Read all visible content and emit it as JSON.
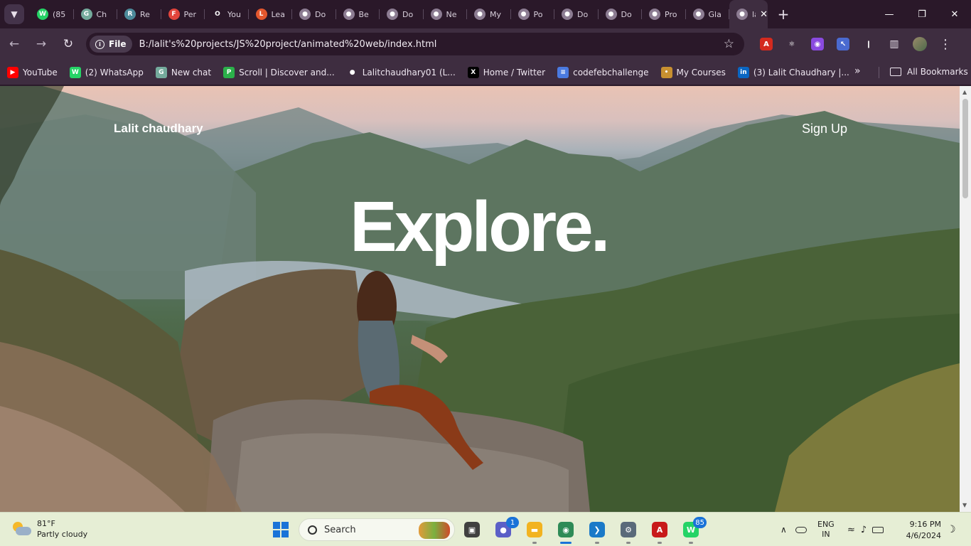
{
  "browser": {
    "tabs": [
      {
        "label": "(85",
        "icon": "whatsapp-icon",
        "color": "#25d366",
        "glyph": "W"
      },
      {
        "label": "Ch",
        "icon": "chatgpt-icon",
        "color": "#74aa9c",
        "glyph": "G"
      },
      {
        "label": "Re",
        "icon": "react-icon",
        "color": "#4c8a9a",
        "glyph": "R"
      },
      {
        "label": "Per",
        "icon": "figma-icon",
        "color": "#e2453c",
        "glyph": "F"
      },
      {
        "label": "You",
        "icon": "github-icon",
        "color": "#2a1829",
        "glyph": "O"
      },
      {
        "label": "Lea",
        "icon": "leetcode-icon",
        "color": "#e4572e",
        "glyph": "L"
      },
      {
        "label": "Do",
        "icon": "globe-icon",
        "color": "#8c7c92",
        "glyph": "●"
      },
      {
        "label": "Be",
        "icon": "globe-icon",
        "color": "#8c7c92",
        "glyph": "●"
      },
      {
        "label": "Do",
        "icon": "globe-icon",
        "color": "#8c7c92",
        "glyph": "●"
      },
      {
        "label": "Ne",
        "icon": "globe-icon",
        "color": "#8c7c92",
        "glyph": "●"
      },
      {
        "label": "My",
        "icon": "globe-icon",
        "color": "#8c7c92",
        "glyph": "●"
      },
      {
        "label": "Po",
        "icon": "globe-icon",
        "color": "#8c7c92",
        "glyph": "●"
      },
      {
        "label": "Do",
        "icon": "globe-icon",
        "color": "#8c7c92",
        "glyph": "●"
      },
      {
        "label": "Do",
        "icon": "globe-icon",
        "color": "#8c7c92",
        "glyph": "●"
      },
      {
        "label": "Pro",
        "icon": "globe-icon",
        "color": "#8c7c92",
        "glyph": "●"
      },
      {
        "label": "Gla",
        "icon": "globe-icon",
        "color": "#8c7c92",
        "glyph": "●"
      },
      {
        "label": "lali",
        "icon": "globe-icon",
        "color": "#8c7c92",
        "glyph": "●"
      }
    ],
    "active_tab_close": "✕",
    "new_tab": "+",
    "window_controls": {
      "minimize": "—",
      "maximize": "❐",
      "close": "✕"
    },
    "nav": {
      "back": "←",
      "forward": "→",
      "reload": "↻"
    },
    "site_chip": "File",
    "url": "B:/lalit's%20projects/JS%20project/animated%20web/index.html",
    "star": "☆",
    "extensions": [
      {
        "name": "pdf-extension-icon",
        "color": "#d42a1e",
        "glyph": "A"
      },
      {
        "name": "react-devtools-icon",
        "color": "#3e2d40",
        "glyph": "⚛"
      },
      {
        "name": "ai-extension-icon",
        "color": "#8a4ae0",
        "glyph": "◉"
      },
      {
        "name": "cursor-extension-icon",
        "color": "#4a6ad0",
        "glyph": "↖"
      },
      {
        "name": "puzzle-extensions-icon",
        "color": "#3e2d40",
        "glyph": "❙"
      }
    ],
    "sidebar_toggle": "▥",
    "menu": "⋮",
    "bookmarks": [
      {
        "label": "YouTube",
        "color": "#ff0000",
        "glyph": "▶"
      },
      {
        "label": "(2) WhatsApp",
        "color": "#25d366",
        "glyph": "W"
      },
      {
        "label": "New chat",
        "color": "#74aa9c",
        "glyph": "G"
      },
      {
        "label": "Scroll | Discover and...",
        "color": "#2bb04a",
        "glyph": "P"
      },
      {
        "label": "Lalitchaudhary01 (L...",
        "color": "#3e2d40",
        "glyph": "●"
      },
      {
        "label": "Home / Twitter",
        "color": "#000000",
        "glyph": "X"
      },
      {
        "label": "codefebchallenge",
        "color": "#4a7ae0",
        "glyph": "≡"
      },
      {
        "label": "My Courses",
        "color": "#c89030",
        "glyph": "•"
      },
      {
        "label": "(3) Lalit Chaudhary |...",
        "color": "#0a66c2",
        "glyph": "in"
      }
    ],
    "bookmarks_more": "»",
    "all_bookmarks": "All Bookmarks"
  },
  "page": {
    "logo": "Lalit chaudhary",
    "signup": "Sign Up",
    "hero": "Explore."
  },
  "taskbar": {
    "weather_temp": "81°F",
    "weather_desc": "Partly cloudy",
    "search_placeholder": "Search",
    "apps": [
      {
        "name": "task-view-icon",
        "color": "#404040",
        "glyph": "▣"
      },
      {
        "name": "teams-chat-icon",
        "color": "#5b5fc7",
        "glyph": "●",
        "badge": "1"
      },
      {
        "name": "file-explorer-icon",
        "color": "#f2b320",
        "glyph": "▬"
      },
      {
        "name": "chrome-icon",
        "color": "#2e8b57",
        "glyph": "◉"
      },
      {
        "name": "vscode-icon",
        "color": "#1a7ac8",
        "glyph": "❯"
      },
      {
        "name": "settings-icon",
        "color": "#5a6a7a",
        "glyph": "⚙"
      },
      {
        "name": "acrobat-icon",
        "color": "#c81a1a",
        "glyph": "A"
      },
      {
        "name": "whatsapp-icon",
        "color": "#25d366",
        "glyph": "W",
        "badge": "85"
      }
    ],
    "tray_chevron": "∧",
    "lang_top": "ENG",
    "lang_bottom": "IN",
    "time": "9:16 PM",
    "date": "4/6/2024"
  }
}
